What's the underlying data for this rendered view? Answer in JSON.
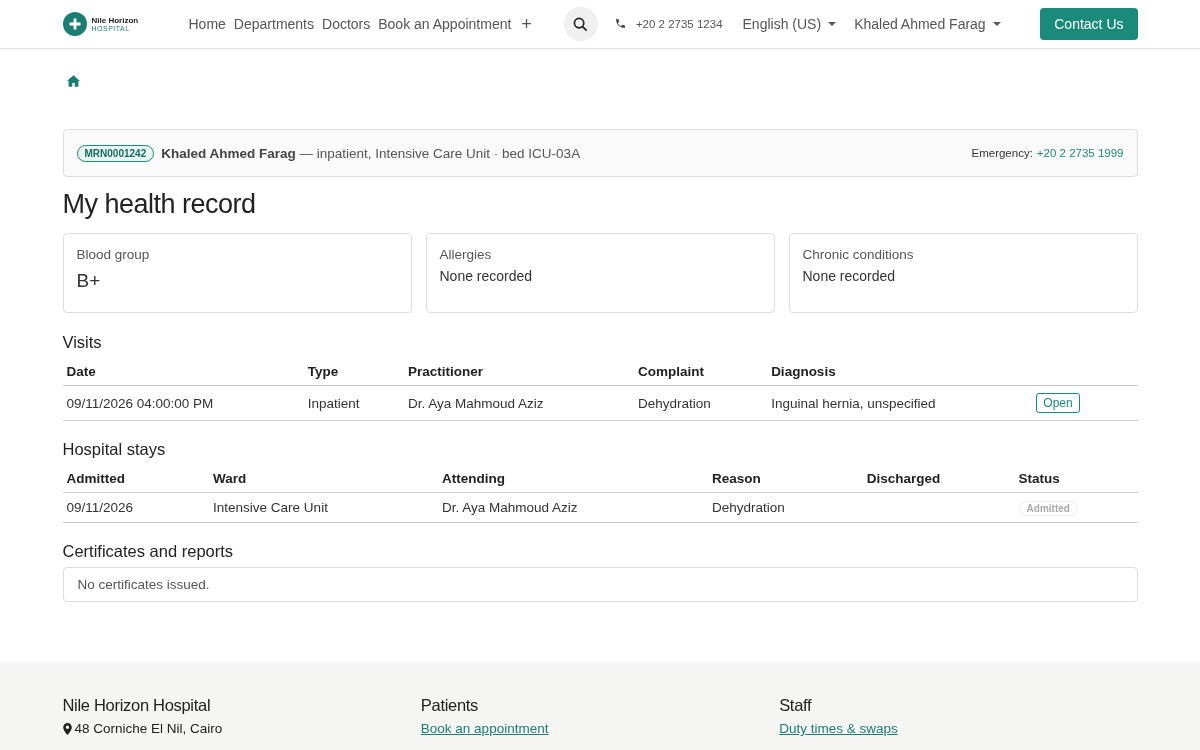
{
  "header": {
    "logo": {
      "name": "Nile Horizon",
      "sub": "HOSPITAL"
    },
    "nav": [
      "Home",
      "Departments",
      "Doctors",
      "Book an Appointment"
    ],
    "more": "+",
    "phone": "+20 2 2735 1234",
    "language": "English (US)",
    "user": "Khaled Ahmed Farag",
    "contact": "Contact Us"
  },
  "patient_banner": {
    "mrn": "MRN0001242",
    "name": "Khaled Ahmed Farag",
    "details": " — inpatient, Intensive Care Unit · bed ICU-03A",
    "emergency_label": "Emergency:",
    "emergency_phone": "+20 2 2735 1999"
  },
  "title": "My health record",
  "summary": [
    {
      "label": "Blood group",
      "value": "B+",
      "kind": "large"
    },
    {
      "label": "Allergies",
      "value": "None recorded",
      "kind": "plain"
    },
    {
      "label": "Chronic conditions",
      "value": "None recorded",
      "kind": "plain"
    }
  ],
  "visits": {
    "title": "Visits",
    "columns": [
      "Date",
      "Type",
      "Practitioner",
      "Complaint",
      "Diagnosis"
    ],
    "rows": [
      {
        "cells": [
          "09/11/2026 04:00:00 PM",
          "Inpatient",
          "Dr. Aya Mahmoud Aziz",
          "Dehydration",
          "Inguinal hernia, unspecified"
        ],
        "action": "Open"
      }
    ]
  },
  "stays": {
    "title": "Hospital stays",
    "columns": [
      "Admitted",
      "Ward",
      "Attending",
      "Reason",
      "Discharged",
      "Status"
    ],
    "rows": [
      {
        "cells": [
          "09/11/2026",
          "Intensive Care Unit",
          "Dr. Aya Mahmoud Aziz",
          "Dehydration",
          ""
        ],
        "status": "Admitted"
      }
    ]
  },
  "certificates": {
    "title": "Certificates and reports",
    "empty": "No certificates issued."
  },
  "footer": [
    {
      "title": "Nile Horizon Hospital",
      "kind": "address",
      "text": "48 Corniche El Nil, Cairo"
    },
    {
      "title": "Patients",
      "kind": "link",
      "text": "Book an appointment"
    },
    {
      "title": "Staff",
      "kind": "link",
      "text": "Duty times & swaps"
    }
  ]
}
